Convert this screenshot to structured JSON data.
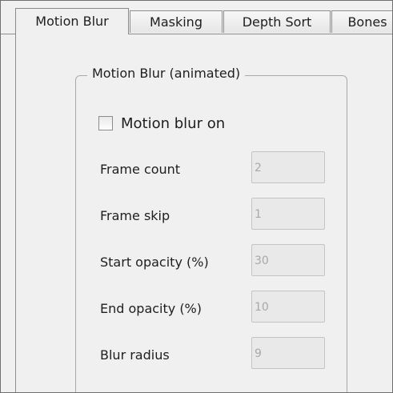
{
  "tabs": [
    {
      "label": "Motion Blur",
      "active": true
    },
    {
      "label": "Masking",
      "active": false
    },
    {
      "label": "Depth Sort",
      "active": false
    },
    {
      "label": "Bones",
      "active": false
    }
  ],
  "group": {
    "title": "Motion Blur (animated)"
  },
  "checkbox": {
    "label": "Motion blur on",
    "checked": false
  },
  "fields": [
    {
      "label": "Frame count",
      "value": "2"
    },
    {
      "label": "Frame skip",
      "value": "1"
    },
    {
      "label": "Start opacity (%)",
      "value": "30"
    },
    {
      "label": "End opacity (%)",
      "value": "10"
    },
    {
      "label": "Blur radius",
      "value": "9"
    }
  ],
  "colors": {
    "panel_background": "#f0f0f0",
    "border": "#8e8e8e",
    "disabled_text": "#a8a8a8"
  }
}
